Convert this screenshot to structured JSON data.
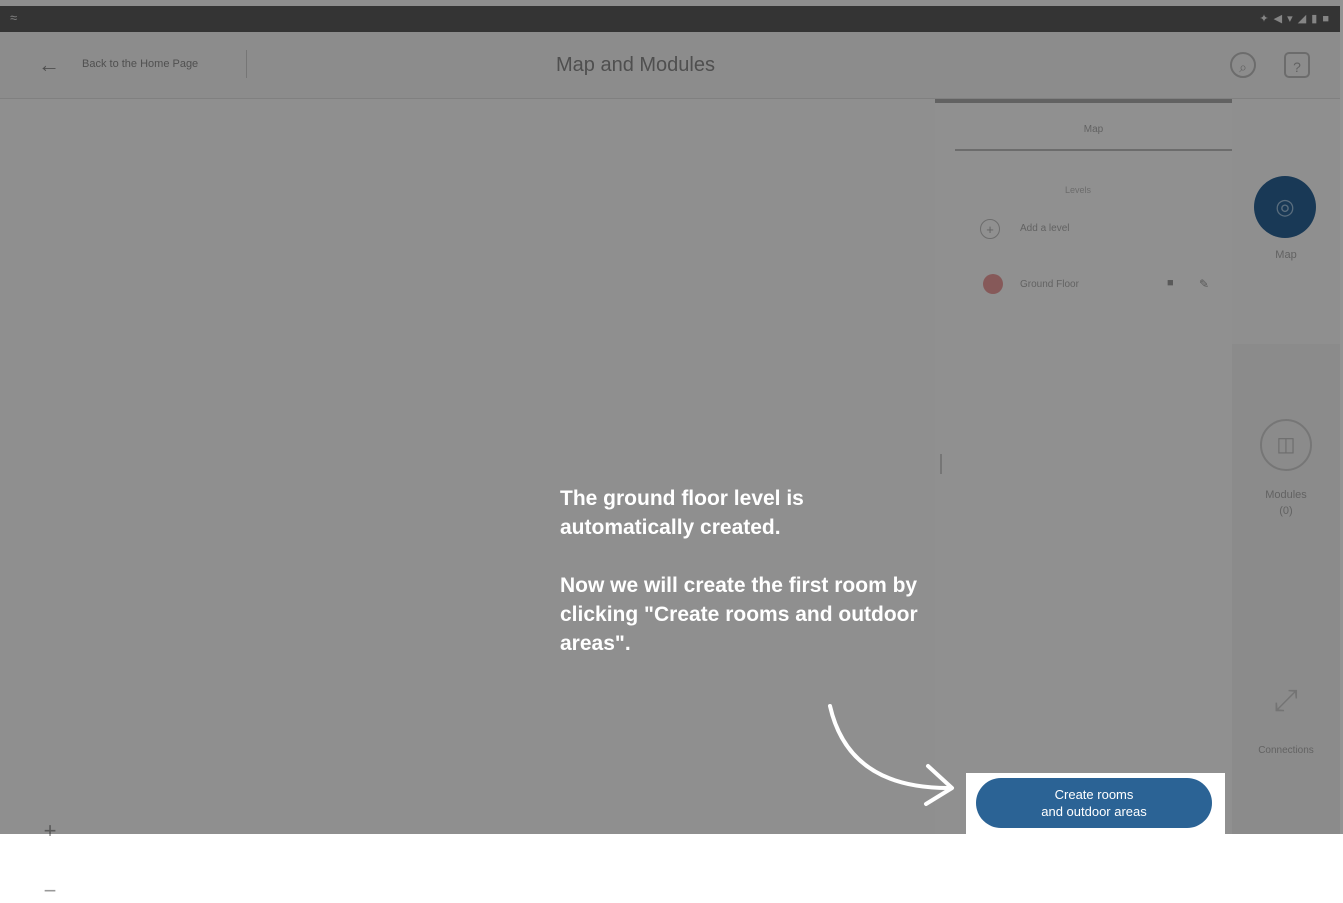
{
  "status_bar": {
    "left_glyph": "≈",
    "right_info": "✦ ◀ ▾ ◢ ▮ ■"
  },
  "header": {
    "back_icon": "arrow-left-icon",
    "back_label": "Back to the Home Page",
    "title": "Map and Modules",
    "icons": [
      "search-icon",
      "help-icon"
    ]
  },
  "map_panel": {
    "tab_label": "Map",
    "levels_label": "Levels",
    "add_level_label": "Add a level",
    "levels": [
      {
        "name": "Ground Floor",
        "color": "#e79a9a",
        "actions": [
          "delete-icon",
          "edit-icon"
        ]
      }
    ]
  },
  "side_rail": {
    "items": [
      {
        "label": "Map",
        "icon": "map-icon",
        "active": true,
        "color": "#2b6395"
      },
      {
        "label": "Modules\n(0)",
        "icon": "modules-icon",
        "active": false
      },
      {
        "label": "Connections",
        "icon": "connections-icon",
        "active": false
      }
    ]
  },
  "canvas_controls": {
    "zoom_in": "+",
    "zoom_out": "−"
  },
  "tutorial": {
    "paragraph_1": "The ground floor level is automatically created.",
    "paragraph_2": "Now we will create the first room by clicking \"Create rooms and outdoor areas\"."
  },
  "cta": {
    "line_1": "Create rooms",
    "line_2": "and outdoor areas",
    "color": "#2b6395"
  }
}
